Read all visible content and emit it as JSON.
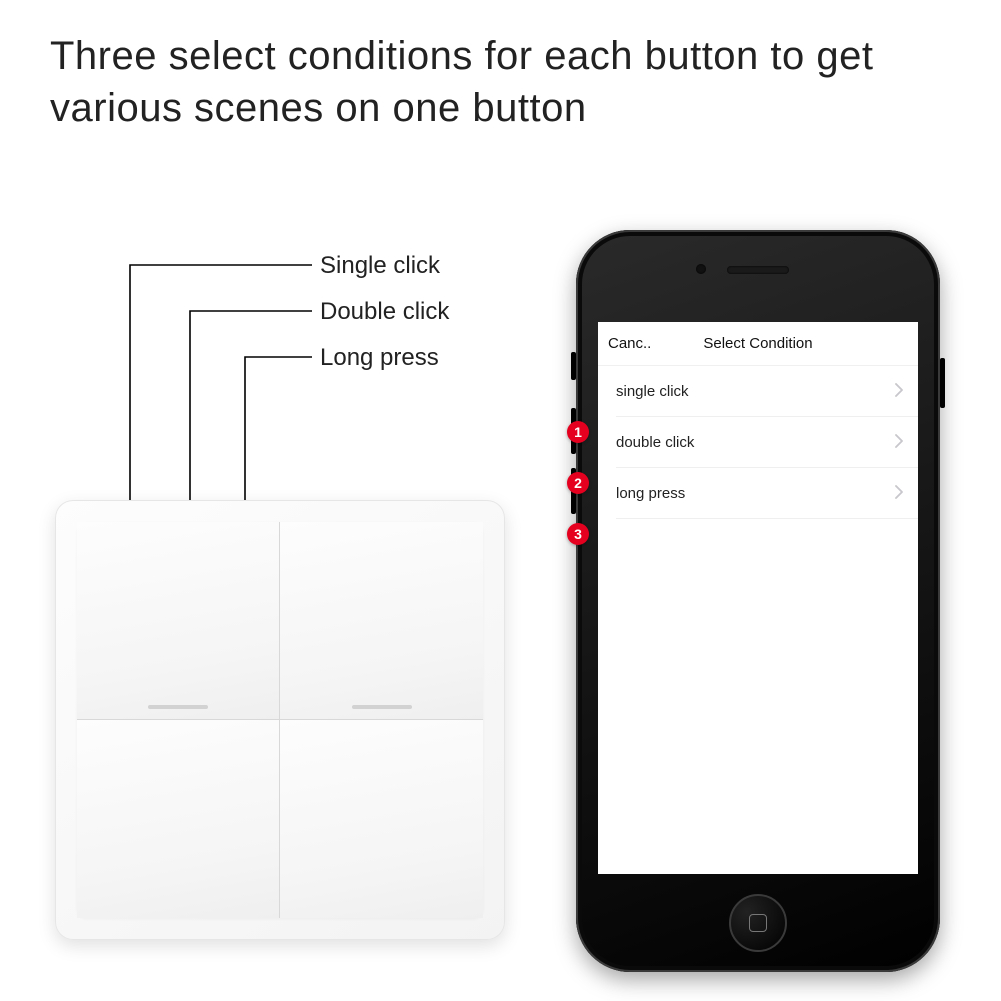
{
  "headline": "Three select conditions for each button to get various scenes on one button",
  "callouts": {
    "c1": "Single click",
    "c2": "Double click",
    "c3": "Long press"
  },
  "phone": {
    "nav_cancel": "Canc..",
    "nav_title": "Select Condition",
    "rows": [
      {
        "label": "single click"
      },
      {
        "label": "double click"
      },
      {
        "label": "long press"
      }
    ],
    "badges": {
      "b1": "1",
      "b2": "2",
      "b3": "3"
    }
  }
}
